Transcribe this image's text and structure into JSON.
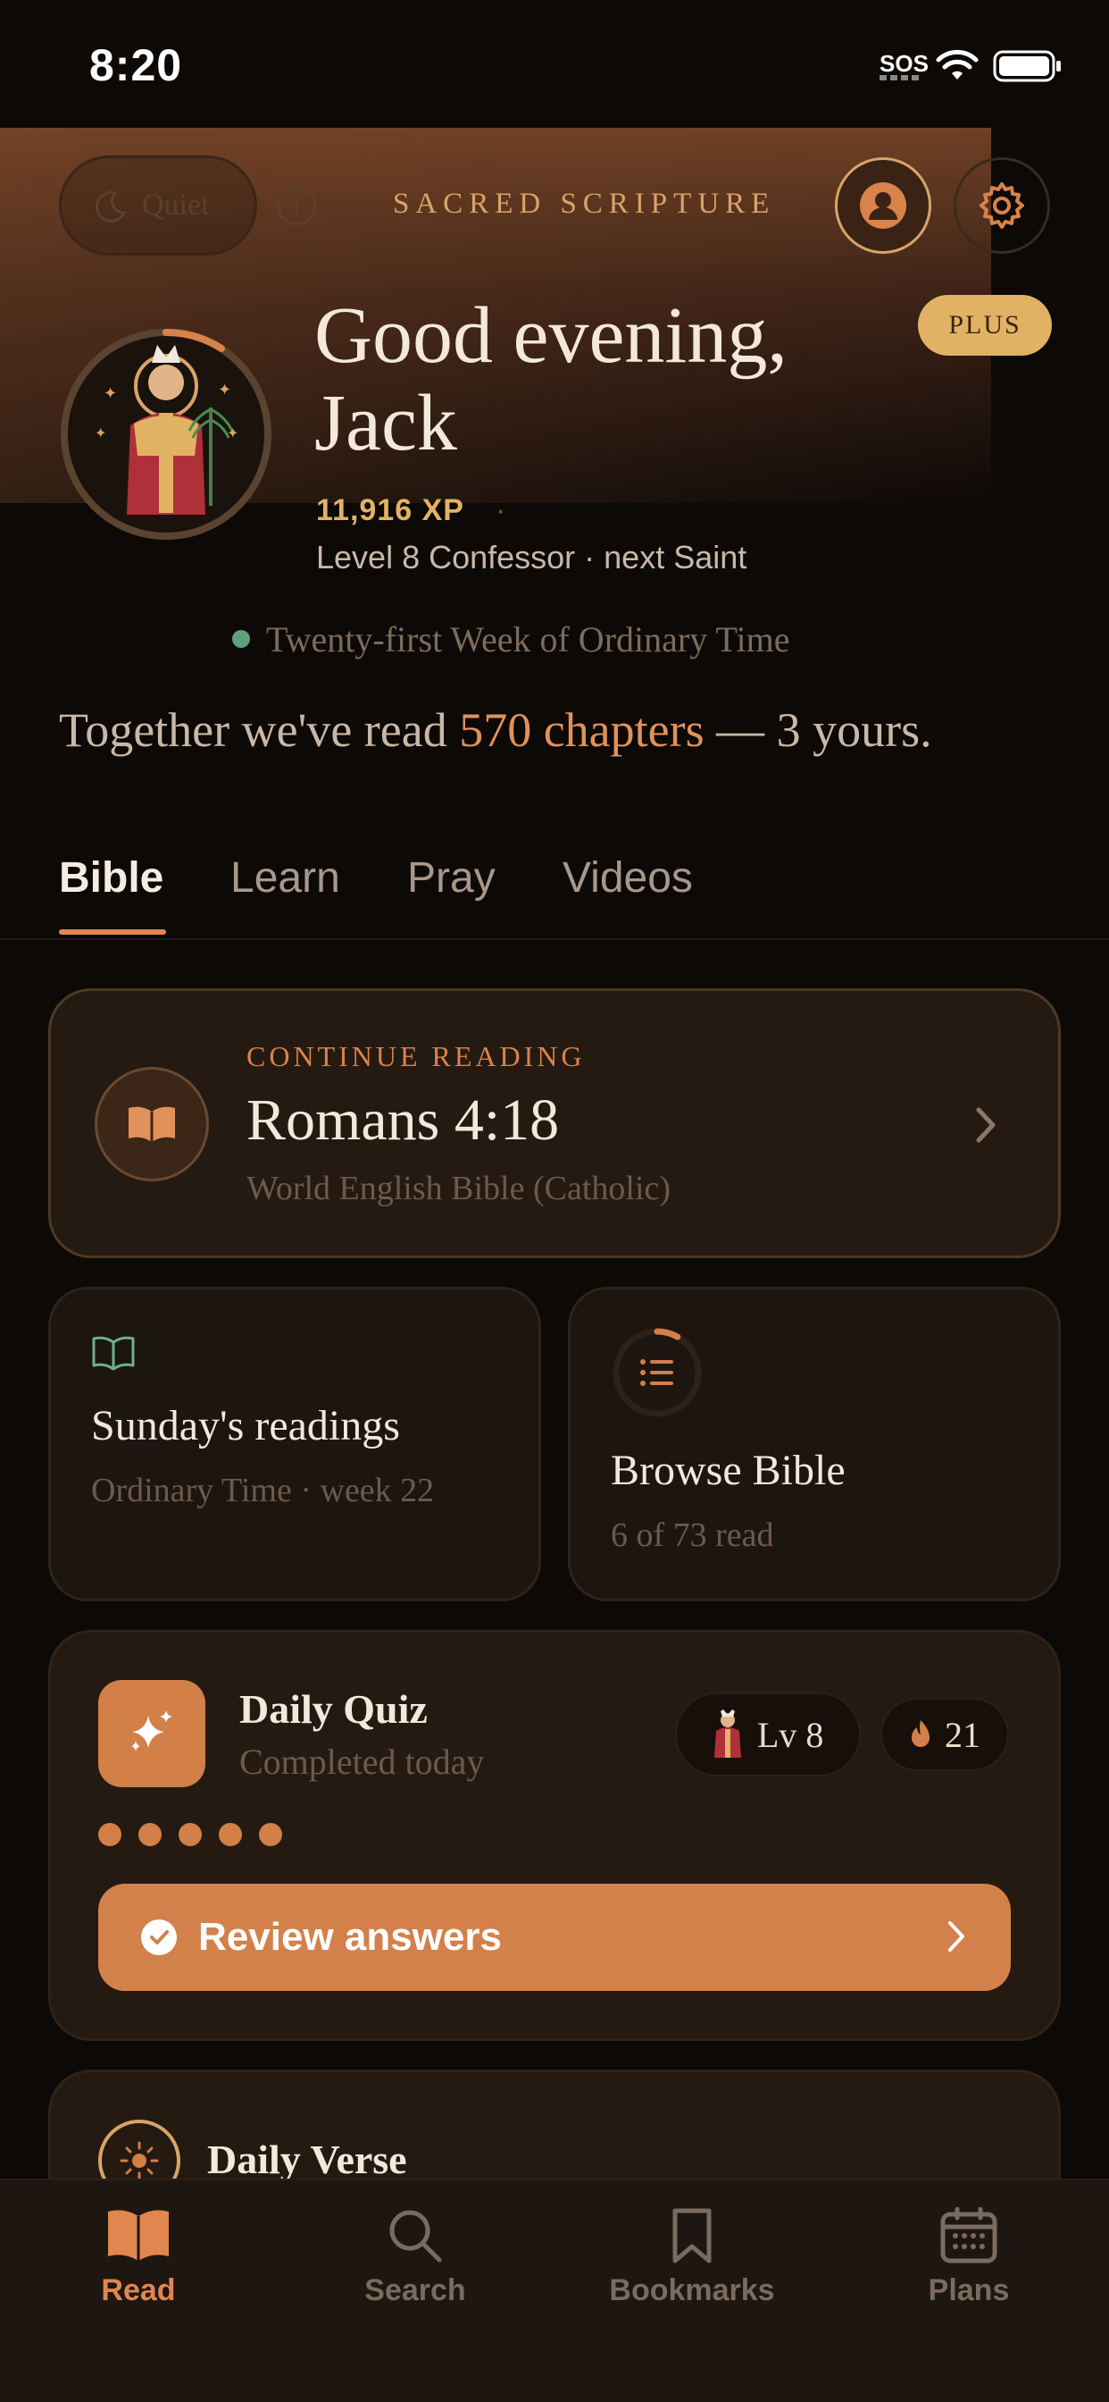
{
  "status_bar": {
    "time": "8:20",
    "sos": "SOS"
  },
  "header": {
    "quiet_label": "Quiet",
    "info_symbol": "i",
    "app_title": "SACRED SCRIPTURE",
    "plus_badge": "PLUS",
    "icons": [
      "moon-icon",
      "info-icon",
      "profile-icon",
      "gear-icon"
    ]
  },
  "greeting": {
    "line1": "Good evening,",
    "line2": "Jack",
    "xp": "11,916 XP",
    "xp_separator": "·",
    "level": "Level 8 Confessor · next Saint"
  },
  "season": {
    "text": "Twenty-first Week of Ordinary Time",
    "dot_color": "#5fa07a"
  },
  "together": {
    "prefix": "Together we've read ",
    "highlight": "570 chapters",
    "suffix": " — 3 yours."
  },
  "tabs": [
    "Bible",
    "Learn",
    "Pray",
    "Videos"
  ],
  "active_tab": "Bible",
  "continue_reading": {
    "label": "CONTINUE READING",
    "reference": "Romans 4:18",
    "version": "World English Bible (Catholic)"
  },
  "sunday_card": {
    "title": "Sunday's readings",
    "subtitle": "Ordinary Time · week 22"
  },
  "browse_card": {
    "title": "Browse Bible",
    "subtitle": "6 of 73 read",
    "progress_fraction": 0.082
  },
  "quiz": {
    "title": "Daily Quiz",
    "subtitle": "Completed today",
    "level_pill": "Lv 8",
    "streak": "21",
    "answered_dots": 5,
    "review_label": "Review answers"
  },
  "daily_verse": {
    "title": "Daily Verse"
  },
  "bottom_nav": {
    "items": [
      {
        "label": "Read",
        "icon": "open-book-icon",
        "active": true
      },
      {
        "label": "Search",
        "icon": "search-icon",
        "active": false
      },
      {
        "label": "Bookmarks",
        "icon": "bookmark-icon",
        "active": false
      },
      {
        "label": "Plans",
        "icon": "calendar-icon",
        "active": false
      }
    ]
  },
  "colors": {
    "accent": "#e0864e",
    "gold": "#e2b264",
    "background": "#0d0907"
  }
}
